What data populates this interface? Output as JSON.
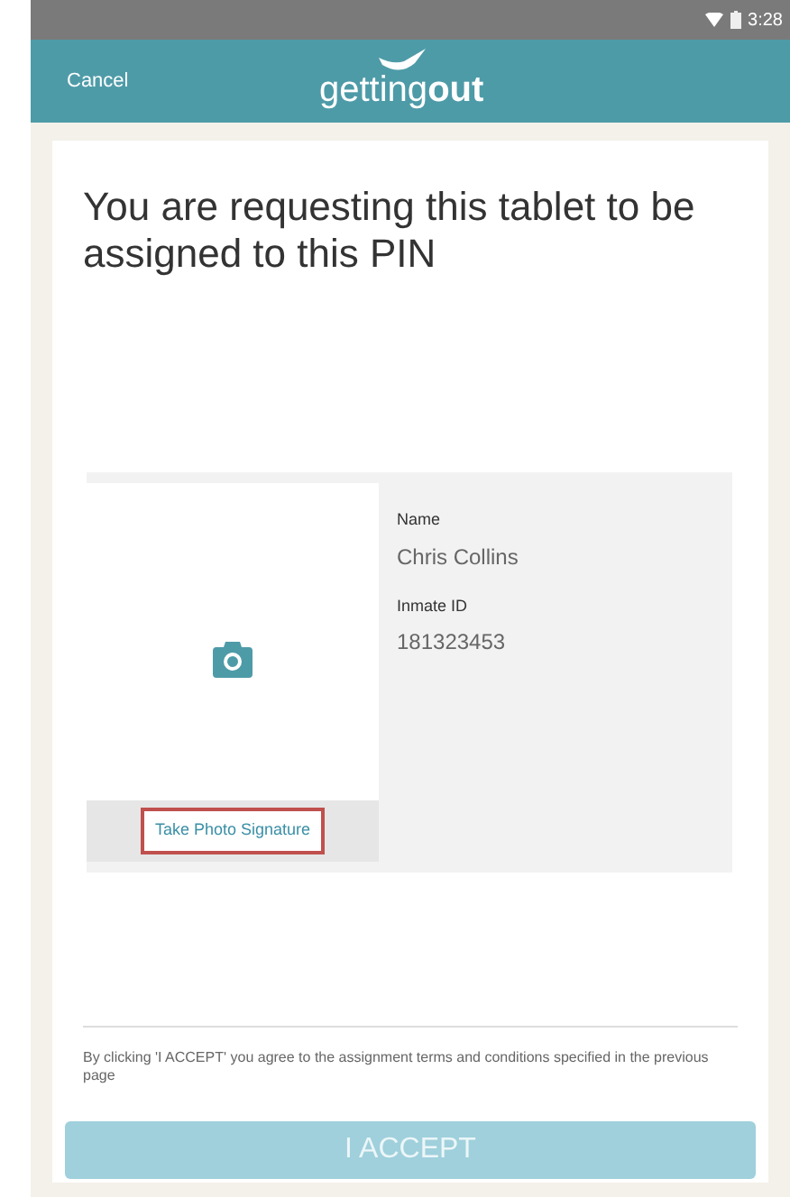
{
  "status_bar": {
    "time": "3:28"
  },
  "header": {
    "cancel": "Cancel",
    "logo": "getting**out**"
  },
  "title": "You are requesting this tablet to be assigned to this PIN",
  "profile": {
    "photo_button": {
      "label": "Take Photo Signature",
      "highlighted": true
    },
    "fields": [
      {
        "label": "Name",
        "value": "Chris Collins"
      },
      {
        "label": "Inmate ID",
        "value": "181323453"
      }
    ]
  },
  "terms": "By clicking 'I ACCEPT' you agree to the assignment terms and conditions specified in the previous page",
  "accept_button": {
    "label": "I ACCEPT",
    "disabled": true
  }
}
